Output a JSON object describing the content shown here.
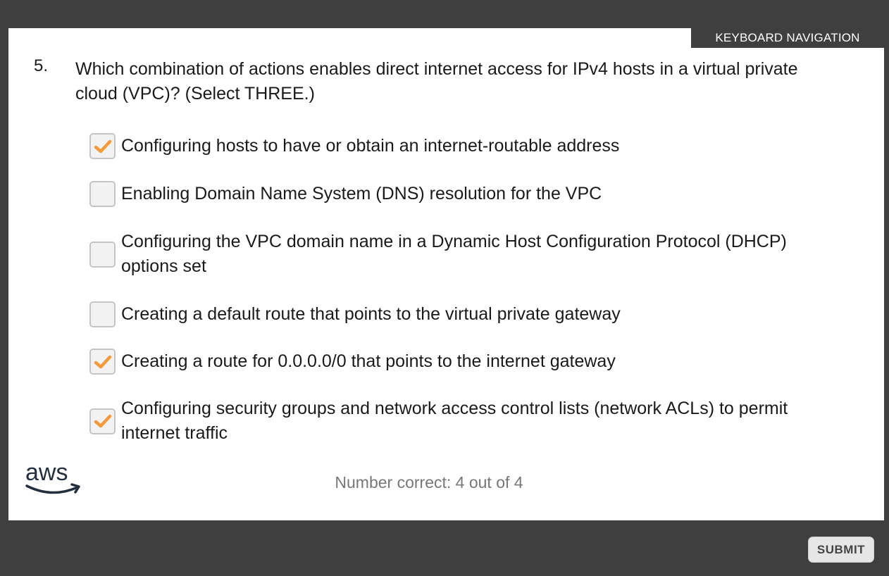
{
  "header": {
    "keyboard_nav_label": "KEYBOARD NAVIGATION"
  },
  "question": {
    "number": "5.",
    "text": "Which combination of actions enables direct internet access for IPv4 hosts in a virtual private cloud (VPC)? (Select THREE.)"
  },
  "options": [
    {
      "label": "Configuring hosts to have or obtain an internet-routable address",
      "checked": true
    },
    {
      "label": "Enabling Domain Name System (DNS) resolution for the VPC",
      "checked": false
    },
    {
      "label": "Configuring the VPC domain name in a Dynamic Host Configuration Protocol (DHCP) options set",
      "checked": false
    },
    {
      "label": "Creating a default route that points to the virtual private gateway",
      "checked": false
    },
    {
      "label": "Creating a route for 0.0.0.0/0 that points to the internet gateway",
      "checked": true
    },
    {
      "label": "Configuring security groups and network access control lists (network ACLs) to permit internet traffic",
      "checked": true
    }
  ],
  "footer": {
    "logo_text": "aws",
    "score_text": "Number correct: 4 out of 4",
    "submit_label": "SUBMIT"
  },
  "colors": {
    "checkmark": "#f59a3c",
    "frame_bg": "#3f3f3f",
    "score_text": "#777777"
  },
  "icons": {
    "check": "checkmark-icon",
    "logo": "aws-logo-icon"
  }
}
